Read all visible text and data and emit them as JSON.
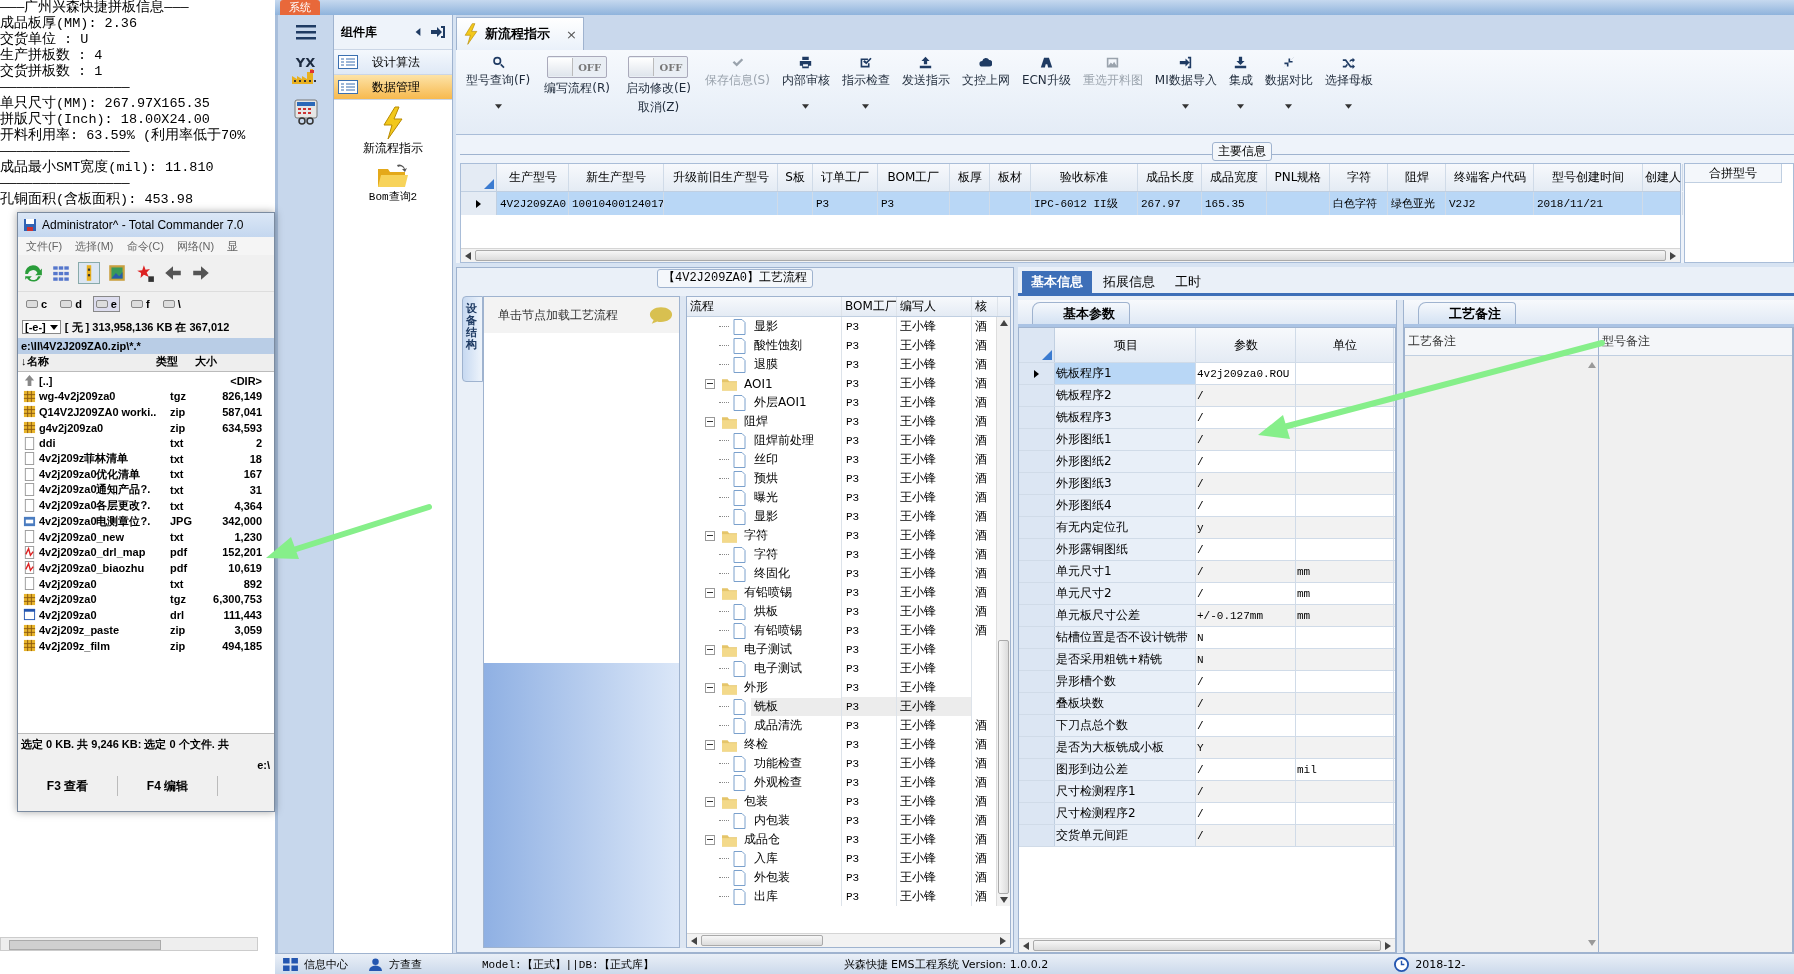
{
  "notepad": {
    "lines": [
      "———广州兴森快捷拼板信息———",
      "成品板厚(MM): 2.36",
      "交货单位 : U",
      "生产拼板数 : 4",
      "交货拼板数 : 1",
      "————————————————",
      "单只尺寸(MM): 267.97X165.35",
      "拼版尺寸(Inch): 18.00X24.00",
      "开料利用率: 63.59% (利用率低于70%",
      "————————————————",
      "成品最小SMT宽度(mil): 11.810",
      "————————————————",
      "孔铜面积(含板面积): 453.98"
    ]
  },
  "file_manager": {
    "title": "Administrator^ - Total Commander 7.0",
    "menu": [
      "文件(F)",
      "选择(M)",
      "命令(C)",
      "网络(N)",
      "显"
    ],
    "drives": [
      {
        "label": "c",
        "selected": false
      },
      {
        "label": "d",
        "selected": false
      },
      {
        "label": "e",
        "selected": true
      },
      {
        "label": "f",
        "selected": false
      },
      {
        "label": "\\",
        "selected": false
      }
    ],
    "drive_select": "[-e-]",
    "free_space": "[ 无 ] 313,958,136 KB 在 367,012",
    "path": "e:\\II\\4V2J209ZA0.zip\\*.*",
    "columns": [
      "↓名称",
      "类型",
      "大小"
    ],
    "files": [
      {
        "kind": "up",
        "name": "[..]",
        "size": "<DIR>"
      },
      {
        "kind": "archive",
        "name": "wg-4v2j209za0",
        "type": "tgz",
        "size": "826,149"
      },
      {
        "kind": "archive",
        "name": "Q14V2J209ZA0 worki..",
        "type": "zip",
        "size": "587,041"
      },
      {
        "kind": "archive",
        "name": "g4v2j209za0",
        "type": "zip",
        "size": "634,593"
      },
      {
        "kind": "text",
        "name": "ddi",
        "type": "txt",
        "size": "2"
      },
      {
        "kind": "text",
        "name": "4v2j209z菲林清单",
        "type": "txt",
        "size": "18"
      },
      {
        "kind": "text",
        "name": "4v2j209za0优化清单",
        "type": "txt",
        "size": "167"
      },
      {
        "kind": "text",
        "name": "4v2j209za0通知产品?.",
        "type": "txt",
        "size": "31"
      },
      {
        "kind": "text",
        "name": "4v2j209za0各层更改?.",
        "type": "txt",
        "size": "4,364"
      },
      {
        "kind": "image",
        "name": "4v2j209za0电测章位?.",
        "type": "JPG",
        "size": "342,000"
      },
      {
        "kind": "text",
        "name": "4v2j209za0_new",
        "type": "txt",
        "size": "1,230"
      },
      {
        "kind": "pdf",
        "name": "4v2j209za0_drl_map",
        "type": "pdf",
        "size": "152,201"
      },
      {
        "kind": "pdf",
        "name": "4v2j209za0_biaozhu",
        "type": "pdf",
        "size": "10,619"
      },
      {
        "kind": "text",
        "name": "4v2j209za0",
        "type": "txt",
        "size": "892"
      },
      {
        "kind": "archive",
        "name": "4v2j209za0",
        "type": "tgz",
        "size": "6,300,753"
      },
      {
        "kind": "drl",
        "name": "4v2j209za0",
        "type": "drl",
        "size": "111,443"
      },
      {
        "kind": "archive",
        "name": "4v2j209z_paste",
        "type": "zip",
        "size": "3,059"
      },
      {
        "kind": "archive",
        "name": "4v2j209z_film",
        "type": "zip",
        "size": "494,185"
      }
    ],
    "status": "选定 0 KB. 共 9,246 KB: 选定 0 个文件. 共",
    "path_bottom": "e:\\",
    "function_keys": [
      "F3 查看",
      "F4 编辑"
    ]
  },
  "app": {
    "system_tab": "系统",
    "logo_text": "YX",
    "components": {
      "title": "组件库",
      "items": [
        {
          "label": "设计算法",
          "selected": false
        },
        {
          "label": "数据管理",
          "selected": true
        }
      ],
      "tools": [
        "新流程指示",
        "Bom查询2"
      ]
    },
    "doc_tab": {
      "title": "新流程指示",
      "close": "×"
    },
    "toolbar": [
      {
        "kind": "button",
        "label": "型号查询(F)",
        "disabled": false,
        "dropdown": true
      },
      {
        "kind": "toggle",
        "label": "编写流程(R)",
        "on": false,
        "toggle_text": "OFF"
      },
      {
        "kind": "toggle",
        "label": "启动修改(E)",
        "sublabel": "取消(Z)",
        "on": false,
        "toggle_text": "OFF"
      },
      {
        "kind": "button",
        "label": "保存信息(S)",
        "disabled": true,
        "dropdown": false
      },
      {
        "kind": "button",
        "label": "内部审核",
        "disabled": false,
        "dropdown": true
      },
      {
        "kind": "button",
        "label": "指示检查",
        "disabled": false,
        "dropdown": true
      },
      {
        "kind": "button",
        "label": "发送指示",
        "disabled": false,
        "dropdown": false
      },
      {
        "kind": "button",
        "label": "文控上网",
        "disabled": false,
        "dropdown": false
      },
      {
        "kind": "button",
        "label": "ECN升级",
        "disabled": false,
        "dropdown": false
      },
      {
        "kind": "button",
        "label": "重选开料图",
        "disabled": true,
        "dropdown": false
      },
      {
        "kind": "button",
        "label": "MI数据导入",
        "disabled": false,
        "dropdown": true
      },
      {
        "kind": "button",
        "label": "集成",
        "disabled": false,
        "dropdown": true
      },
      {
        "kind": "button",
        "label": "数据对比",
        "disabled": false,
        "dropdown": true
      },
      {
        "kind": "button",
        "label": "选择母板",
        "disabled": false,
        "dropdown": true
      }
    ],
    "main_info": {
      "title": "主要信息",
      "columns": [
        "生产型号",
        "新生产型号",
        "升级前旧生产型号",
        "S板",
        "订单工厂",
        "BOM工厂",
        "板厚",
        "板材",
        "验收标准",
        "成品长度",
        "成品宽度",
        "PNL规格",
        "字符",
        "阻焊",
        "终端客户代码",
        "型号创建时间",
        "创建人"
      ],
      "rows": [
        {
          "selected": true,
          "cells": [
            "4V2J209ZA0",
            "10010400124017",
            "",
            "",
            "P3",
            "P3",
            "",
            "",
            "IPC-6012 II级",
            "267.97",
            "165.35",
            "",
            "白色字符",
            "绿色亚光",
            "V2J2",
            "2018/11/21",
            ""
          ]
        }
      ],
      "merge_column": "合拼型号"
    },
    "process": {
      "title": "【4V2J209ZA0】工艺流程",
      "side_tab": "设备结构",
      "hint": "单击节点加载工艺流程",
      "columns": [
        "流程",
        "BOM工厂",
        "编写人",
        "核"
      ],
      "tree": [
        {
          "children": [
            {
              "label": "显影",
              "bom": "P3",
              "writer": "王小锋",
              "reviewer": "酒",
              "selected": false
            },
            {
              "label": "酸性蚀刻",
              "bom": "P3",
              "writer": "王小锋",
              "reviewer": "酒",
              "selected": false
            },
            {
              "label": "退膜",
              "bom": "P3",
              "writer": "王小锋",
              "reviewer": "酒",
              "selected": false
            }
          ]
        },
        {
          "label": "AOI1",
          "bom": "P3",
          "writer": "王小锋",
          "reviewer": "酒",
          "selected": false,
          "expanded": true,
          "children": [
            {
              "label": "外层AOI1",
              "bom": "P3",
              "writer": "王小锋",
              "reviewer": "酒",
              "selected": false
            }
          ]
        },
        {
          "label": "阻焊",
          "bom": "P3",
          "writer": "王小锋",
          "reviewer": "酒",
          "selected": false,
          "expanded": true,
          "children": [
            {
              "label": "阻焊前处理",
              "bom": "P3",
              "writer": "王小锋",
              "reviewer": "酒",
              "selected": false
            },
            {
              "label": "丝印",
              "bom": "P3",
              "writer": "王小锋",
              "reviewer": "酒",
              "selected": false
            },
            {
              "label": "预烘",
              "bom": "P3",
              "writer": "王小锋",
              "reviewer": "酒",
              "selected": false
            },
            {
              "label": "曝光",
              "bom": "P3",
              "writer": "王小锋",
              "reviewer": "酒",
              "selected": false
            },
            {
              "label": "显影",
              "bom": "P3",
              "writer": "王小锋",
              "reviewer": "酒",
              "selected": false
            }
          ]
        },
        {
          "label": "字符",
          "bom": "P3",
          "writer": "王小锋",
          "reviewer": "酒",
          "selected": false,
          "expanded": true,
          "children": [
            {
              "label": "字符",
              "bom": "P3",
              "writer": "王小锋",
              "reviewer": "酒",
              "selected": false
            },
            {
              "label": "终固化",
              "bom": "P3",
              "writer": "王小锋",
              "reviewer": "酒",
              "selected": false
            }
          ]
        },
        {
          "label": "有铅喷锡",
          "bom": "P3",
          "writer": "王小锋",
          "reviewer": "酒",
          "selected": false,
          "expanded": true,
          "children": [
            {
              "label": "烘板",
              "bom": "P3",
              "writer": "王小锋",
              "reviewer": "酒",
              "selected": false
            },
            {
              "label": "有铅喷锡",
              "bom": "P3",
              "writer": "王小锋",
              "reviewer": "酒",
              "selected": false
            }
          ]
        },
        {
          "label": "电子测试",
          "bom": "P3",
          "writer": "王小锋",
          "selected": false,
          "expanded": true,
          "children": [
            {
              "label": "电子测试",
              "bom": "P3",
              "writer": "王小锋",
              "selected": false
            }
          ]
        },
        {
          "label": "外形",
          "bom": "P3",
          "writer": "王小锋",
          "selected": false,
          "expanded": true,
          "children": [
            {
              "label": "铣板",
              "bom": "P3",
              "writer": "王小锋",
              "selected": true
            },
            {
              "label": "成品清洗",
              "bom": "P3",
              "writer": "王小锋",
              "reviewer": "酒",
              "selected": false
            }
          ]
        },
        {
          "label": "终检",
          "bom": "P3",
          "writer": "王小锋",
          "reviewer": "酒",
          "selected": false,
          "expanded": true,
          "children": [
            {
              "label": "功能检查",
              "bom": "P3",
              "writer": "王小锋",
              "reviewer": "酒",
              "selected": false
            },
            {
              "label": "外观检查",
              "bom": "P3",
              "writer": "王小锋",
              "reviewer": "酒",
              "selected": false
            }
          ]
        },
        {
          "label": "包装",
          "bom": "P3",
          "writer": "王小锋",
          "reviewer": "酒",
          "selected": false,
          "expanded": true,
          "children": [
            {
              "label": "内包装",
              "bom": "P3",
              "writer": "王小锋",
              "reviewer": "酒",
              "selected": false
            }
          ]
        },
        {
          "label": "成品仓",
          "bom": "P3",
          "writer": "王小锋",
          "reviewer": "酒",
          "selected": false,
          "expanded": true,
          "children": [
            {
              "label": "入库",
              "bom": "P3",
              "writer": "王小锋",
              "reviewer": "酒",
              "selected": false
            },
            {
              "label": "外包装",
              "bom": "P3",
              "writer": "王小锋",
              "reviewer": "酒",
              "selected": false
            },
            {
              "label": "出库",
              "bom": "P3",
              "writer": "王小锋",
              "reviewer": "酒",
              "selected": false
            }
          ]
        }
      ]
    },
    "details": {
      "tabs": [
        {
          "label": "基本信息",
          "selected": true
        },
        {
          "label": "拓展信息",
          "selected": false
        },
        {
          "label": "工时",
          "selected": false
        }
      ],
      "params": {
        "tab": "基本参数",
        "columns": [
          "项目",
          "参数",
          "单位"
        ],
        "rows": [
          {
            "item": "铣板程序1",
            "value": "4v2j209za0.ROU",
            "unit": "",
            "selected": true
          },
          {
            "item": "铣板程序2",
            "value": "/",
            "unit": "",
            "selected": false
          },
          {
            "item": "铣板程序3",
            "value": "/",
            "unit": "",
            "selected": false
          },
          {
            "item": "外形图纸1",
            "value": "/",
            "unit": "",
            "selected": false
          },
          {
            "item": "外形图纸2",
            "value": "/",
            "unit": "",
            "selected": false
          },
          {
            "item": "外形图纸3",
            "value": "/",
            "unit": "",
            "selected": false
          },
          {
            "item": "外形图纸4",
            "value": "/",
            "unit": "",
            "selected": false
          },
          {
            "item": "有无内定位孔",
            "value": "y",
            "unit": "",
            "selected": false
          },
          {
            "item": "外形露铜图纸",
            "value": "/",
            "unit": "",
            "selected": false
          },
          {
            "item": "单元尺寸1",
            "value": "/",
            "unit": "mm",
            "selected": false
          },
          {
            "item": "单元尺寸2",
            "value": "/",
            "unit": "mm",
            "selected": false
          },
          {
            "item": "单元板尺寸公差",
            "value": "+/-0.127mm",
            "unit": "mm",
            "selected": false
          },
          {
            "item": "钻槽位置是否不设计铣带",
            "value": "N",
            "unit": "",
            "selected": false
          },
          {
            "item": "是否采用粗铣+精铣",
            "value": "N",
            "unit": "",
            "selected": false
          },
          {
            "item": "异形槽个数",
            "value": "/",
            "unit": "",
            "selected": false
          },
          {
            "item": "叠板块数",
            "value": "/",
            "unit": "",
            "selected": false
          },
          {
            "item": "下刀点总个数",
            "value": "/",
            "unit": "",
            "selected": false
          },
          {
            "item": "是否为大板铣成小板",
            "value": "Y",
            "unit": "",
            "selected": false
          },
          {
            "item": "图形到边公差",
            "value": "/",
            "unit": "mil",
            "selected": false
          },
          {
            "item": "尺寸检测程序1",
            "value": "/",
            "unit": "",
            "selected": false
          },
          {
            "item": "尺寸检测程序2",
            "value": "/",
            "unit": "",
            "selected": false
          },
          {
            "item": "交货单元间距",
            "value": "/",
            "unit": "",
            "selected": false
          }
        ]
      },
      "notes": {
        "tab": "工艺备注",
        "columns": [
          "工艺备注",
          "型号备注"
        ]
      }
    },
    "status_bar": {
      "items": [
        "信息中心",
        "方查查"
      ],
      "model": "Model:【正式】||DB:【正式库】",
      "version": "兴森快捷 EMS工程系统 Version: 1.0.0.2",
      "date": "2018-12-"
    }
  }
}
